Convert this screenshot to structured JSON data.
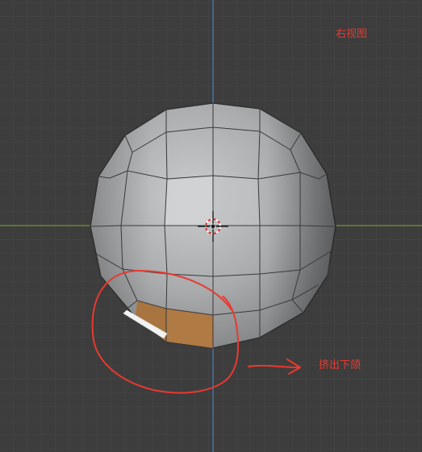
{
  "viewport": {
    "view_name": "右视图",
    "annotation": "挤出下颌"
  },
  "colors": {
    "background": "#3d3d3d",
    "grid_minor": "#474747",
    "grid_major": "#2f2f2f",
    "axis_x": "#6f9a2a",
    "axis_z": "#4f7fb8",
    "mesh_light": "#c4c6c8",
    "mesh_mid": "#9c9ea0",
    "mesh_dark": "#6b6d6f",
    "edge": "#2e2e2e",
    "selected_face": "#b07a45",
    "selected_edge": "#f2f2f2",
    "annotation": "#e8392f"
  },
  "icons": {
    "cursor": "3d-cursor-icon",
    "arrow": "arrow-right-icon"
  }
}
